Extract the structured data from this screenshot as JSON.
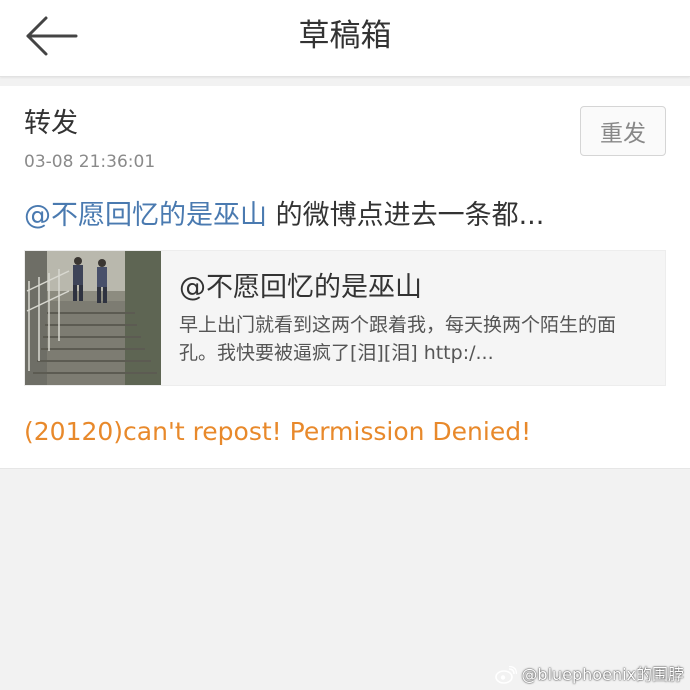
{
  "header": {
    "title": "草稿箱",
    "back_icon": "arrow-left-icon"
  },
  "draft": {
    "type_label": "转发",
    "timestamp": "03-08 21:36:01",
    "resend_label": "重发",
    "text_mention": "@不愿回忆的是巫山",
    "text_rest": " 的微博点进去一条都...",
    "quote": {
      "author": "@不愿回忆的是巫山",
      "body": "早上出门就看到这两个跟着我，每天换两个陌生的面孔。我快要被逼疯了[泪][泪] http:/..."
    },
    "error": "(20120)can't repost! Permission Denied!"
  },
  "watermark": {
    "text": "@bluephoenix的围脖",
    "icon": "weibo-logo-icon"
  },
  "colors": {
    "mention": "#4a7ab0",
    "error": "#e8892b",
    "background": "#f2f2f2"
  }
}
